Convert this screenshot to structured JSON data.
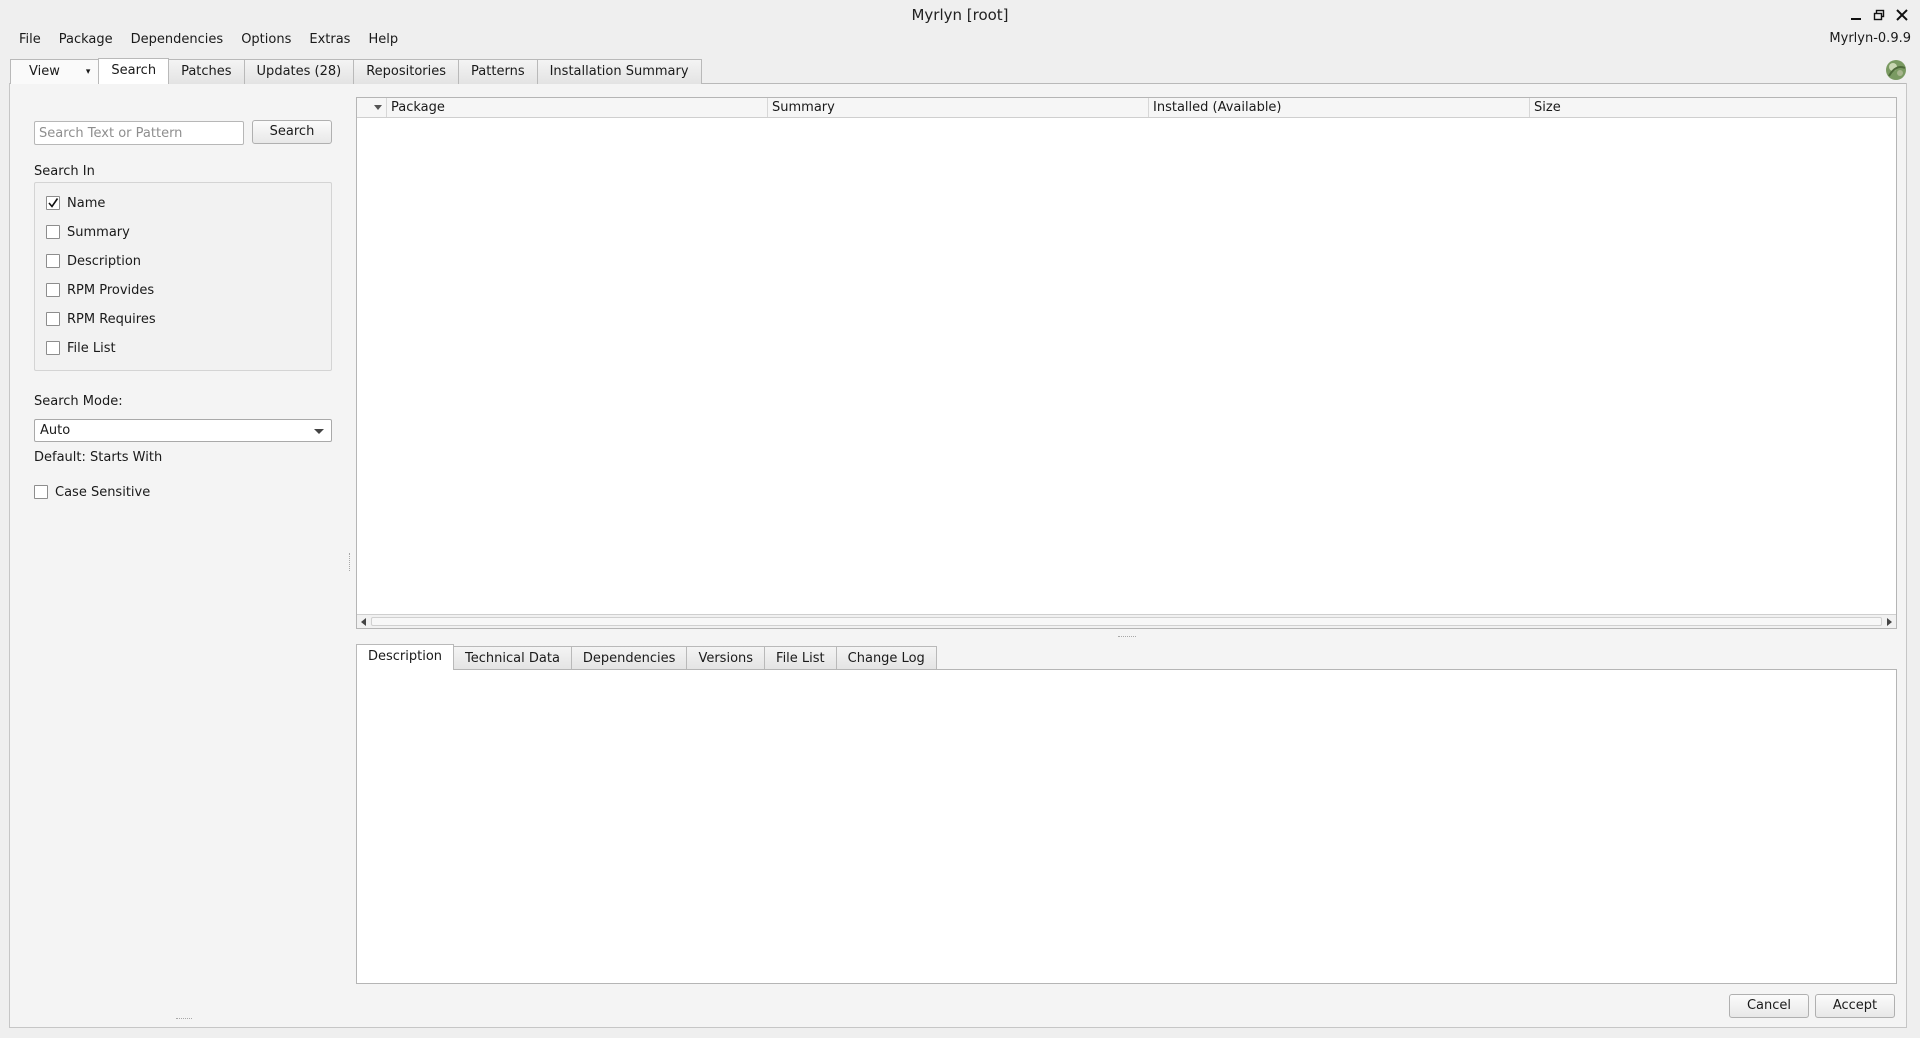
{
  "window": {
    "title": "Myrlyn [root]",
    "version": "Myrlyn-0.9.9"
  },
  "menubar": {
    "items": [
      "File",
      "Package",
      "Dependencies",
      "Options",
      "Extras",
      "Help"
    ]
  },
  "top_tabs": {
    "view_label": "View",
    "items": [
      "Search",
      "Patches",
      "Updates (28)",
      "Repositories",
      "Patterns",
      "Installation Summary"
    ],
    "active": "Search"
  },
  "search": {
    "placeholder": "Search Text or Pattern",
    "value": "",
    "button_label": "Search",
    "search_in_label": "Search In",
    "options": [
      {
        "label": "Name",
        "checked": true
      },
      {
        "label": "Summary",
        "checked": false
      },
      {
        "label": "Description",
        "checked": false
      },
      {
        "label": "RPM Provides",
        "checked": false
      },
      {
        "label": "RPM Requires",
        "checked": false
      },
      {
        "label": "File List",
        "checked": false
      }
    ],
    "mode_label": "Search Mode:",
    "mode_value": "Auto",
    "default_text": "Default: Starts With",
    "case_sensitive_label": "Case Sensitive",
    "case_sensitive_checked": false
  },
  "package_table": {
    "columns": [
      "Package",
      "Summary",
      "Installed (Available)",
      "Size"
    ],
    "rows": []
  },
  "detail_tabs": {
    "items": [
      "Description",
      "Technical Data",
      "Dependencies",
      "Versions",
      "File List",
      "Change Log"
    ],
    "active": "Description"
  },
  "dialog_buttons": {
    "cancel": "Cancel",
    "accept": "Accept"
  }
}
